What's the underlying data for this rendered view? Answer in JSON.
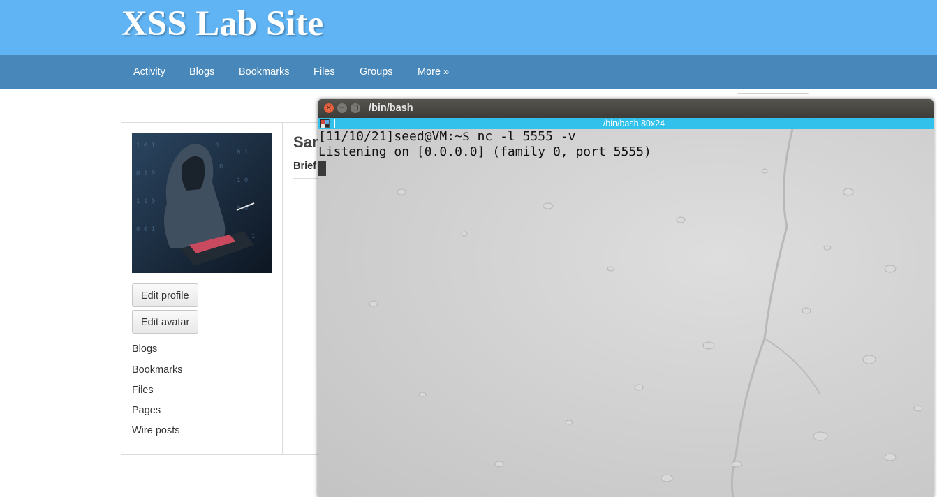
{
  "site": {
    "title": "XSS Lab Site",
    "header_color": "#60b4f4",
    "nav_color": "#4787b9"
  },
  "nav": {
    "items": [
      "Activity",
      "Blogs",
      "Bookmarks",
      "Files",
      "Groups",
      "More »"
    ]
  },
  "profile": {
    "name": "San",
    "brief_label": "Brief",
    "avatar_icon": "hacker-avatar-image",
    "buttons": [
      "Edit profile",
      "Edit avatar"
    ],
    "links": [
      "Blogs",
      "Bookmarks",
      "Files",
      "Pages",
      "Wire posts"
    ]
  },
  "terminal": {
    "window_title": "/bin/bash",
    "tab_title": "/bin/bash 80x24",
    "tab_bar_color": "#31c1ea",
    "lines": [
      "[11/10/21]seed@VM:~$ nc -l 5555 -v",
      "Listening on [0.0.0.0] (family 0, port 5555)"
    ]
  }
}
